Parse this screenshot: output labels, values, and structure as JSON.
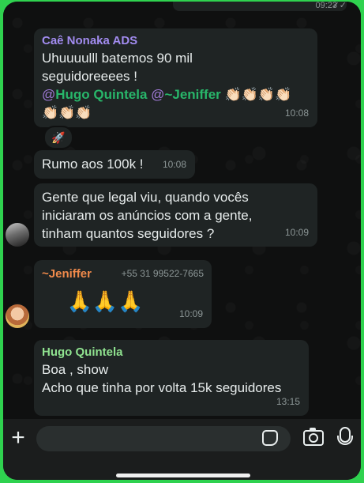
{
  "status": {
    "top_time": "09:23",
    "top_ticks": "✓✓"
  },
  "messages": [
    {
      "sender": "Caê Nonaka ADS",
      "text": "Uhuuuulll batemos 90 mil seguidoreeees !",
      "mention1": "@Hugo Quintela",
      "mention2": "@~Jeniffer",
      "emojis_line1": "👏🏻👏🏻👏🏻👏🏻",
      "emojis_line2": "👏🏻👏🏻👏🏻",
      "time": "10:08",
      "reaction": "🚀"
    },
    {
      "text": "Rumo aos 100k !",
      "time": "10:08"
    },
    {
      "text": "Gente que legal viu, quando vocês iniciaram os anúncios com a gente, tinham quantos seguidores ?",
      "time": "10:09"
    },
    {
      "sender": "~Jeniffer",
      "phone": "+55 31 99522-7665",
      "text": "🙏🙏🙏",
      "time": "10:09"
    },
    {
      "sender": "Hugo Quintela",
      "line1": "Boa , show",
      "line2": "Acho que tinha por volta 15k seguidores",
      "time": "13:15"
    }
  ],
  "colors": {
    "sender_cae": "#a28cf0",
    "sender_jeniffer": "#f08a4b",
    "sender_hugo": "#8fe28f",
    "mention": "#28b66a"
  },
  "icons": {
    "attach": "plus-icon",
    "sticker": "sticker-icon",
    "camera": "camera-icon",
    "mic": "microphone-icon"
  },
  "input": {
    "value": "",
    "placeholder": ""
  }
}
